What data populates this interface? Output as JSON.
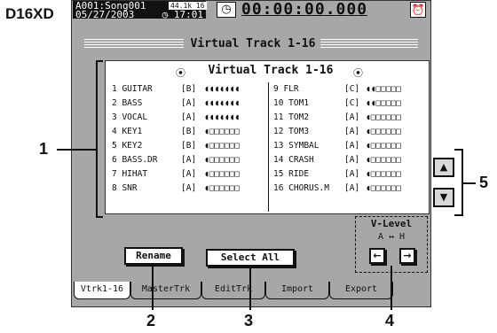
{
  "model": "D16XD",
  "status": {
    "song": "A001:Song001",
    "date": "05/27/2003",
    "badge": "44.1k 16",
    "time": "◷ 17:01",
    "counter": "00:00:00.000"
  },
  "screen_title": "Virtual Track 1-16",
  "panel_title": "Virtual Track 1-16",
  "tracks_left": [
    {
      "name": "1 GUITAR",
      "param": "[B]",
      "level": "◖◖◖◖◖◖◖"
    },
    {
      "name": "2 BASS",
      "param": "[A]",
      "level": "◖◖◖◖◖◖◖"
    },
    {
      "name": "3 VOCAL",
      "param": "[A]",
      "level": "◖◖◖◖◖◖◖"
    },
    {
      "name": "4 KEY1",
      "param": "[B]",
      "level": "◖□□□□□□"
    },
    {
      "name": "5 KEY2",
      "param": "[B]",
      "level": "◖□□□□□□"
    },
    {
      "name": "6 BASS.DR",
      "param": "[A]",
      "level": "◖□□□□□□"
    },
    {
      "name": "7 HIHAT",
      "param": "[A]",
      "level": "◖□□□□□□"
    },
    {
      "name": "8 SNR",
      "param": "[A]",
      "level": "◖□□□□□□"
    }
  ],
  "tracks_right": [
    {
      "name": "9 FLR",
      "param": "[C]",
      "level": "◖◖□□□□□"
    },
    {
      "name": "10 TOM1",
      "param": "[C]",
      "level": "◖◖□□□□□"
    },
    {
      "name": "11 TOM2",
      "param": "[A]",
      "level": "◖□□□□□□"
    },
    {
      "name": "12 TOM3",
      "param": "[A]",
      "level": "◖□□□□□□"
    },
    {
      "name": "13 SYMBAL",
      "param": "[A]",
      "level": "◖□□□□□□"
    },
    {
      "name": "14 CRASH",
      "param": "[A]",
      "level": "◖□□□□□□"
    },
    {
      "name": "15 RIDE",
      "param": "[A]",
      "level": "◖□□□□□□"
    },
    {
      "name": "16 CHORUS.M",
      "param": "[A]",
      "level": "◖□□□□□□"
    }
  ],
  "buttons": {
    "rename": "Rename",
    "select_all": "Select All"
  },
  "vlevel": {
    "label": "V-Level",
    "range": "A ↔ H",
    "left": "←",
    "right": "→"
  },
  "scroll": {
    "up": "▲",
    "down": "▼"
  },
  "tabs": [
    "Vtrk1-16",
    "MasterTrk",
    "EditTrk",
    "Import",
    "Export"
  ],
  "callouts": {
    "c1": "1",
    "c2": "2",
    "c3": "3",
    "c4": "4",
    "c5": "5"
  }
}
